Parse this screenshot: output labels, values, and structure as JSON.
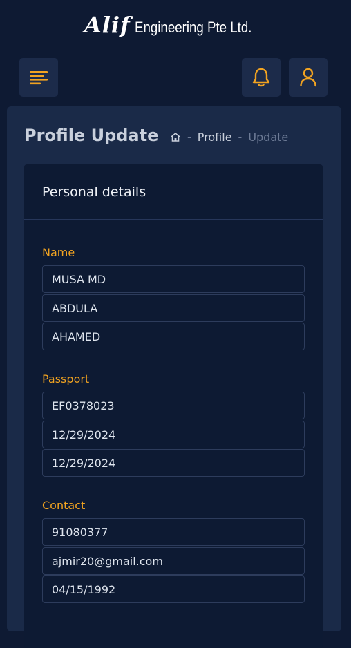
{
  "brand": {
    "logo_mark": "Alif",
    "logo_text": "Engineering Pte Ltd."
  },
  "colors": {
    "background": "#0e1a33",
    "panel": "#1a2a48",
    "accent": "#f1a321",
    "field_border": "#2d3c5c"
  },
  "header": {
    "menu_icon": "menu-lines-icon",
    "bell_icon": "bell-icon",
    "user_icon": "user-icon"
  },
  "page": {
    "title": "Profile Update",
    "breadcrumb": {
      "home_icon": "home-icon",
      "separator": "-",
      "items": [
        "Profile",
        "Update"
      ]
    }
  },
  "card": {
    "title": "Personal details",
    "sections": {
      "name": {
        "label": "Name",
        "fields": [
          "MUSA MD",
          "ABDULA",
          "AHAMED"
        ]
      },
      "passport": {
        "label": "Passport",
        "fields": [
          "EF0378023",
          "12/29/2024",
          "12/29/2024"
        ]
      },
      "contact": {
        "label": "Contact",
        "fields": [
          "91080377",
          "ajmir20@gmail.com",
          "04/15/1992"
        ]
      }
    }
  }
}
